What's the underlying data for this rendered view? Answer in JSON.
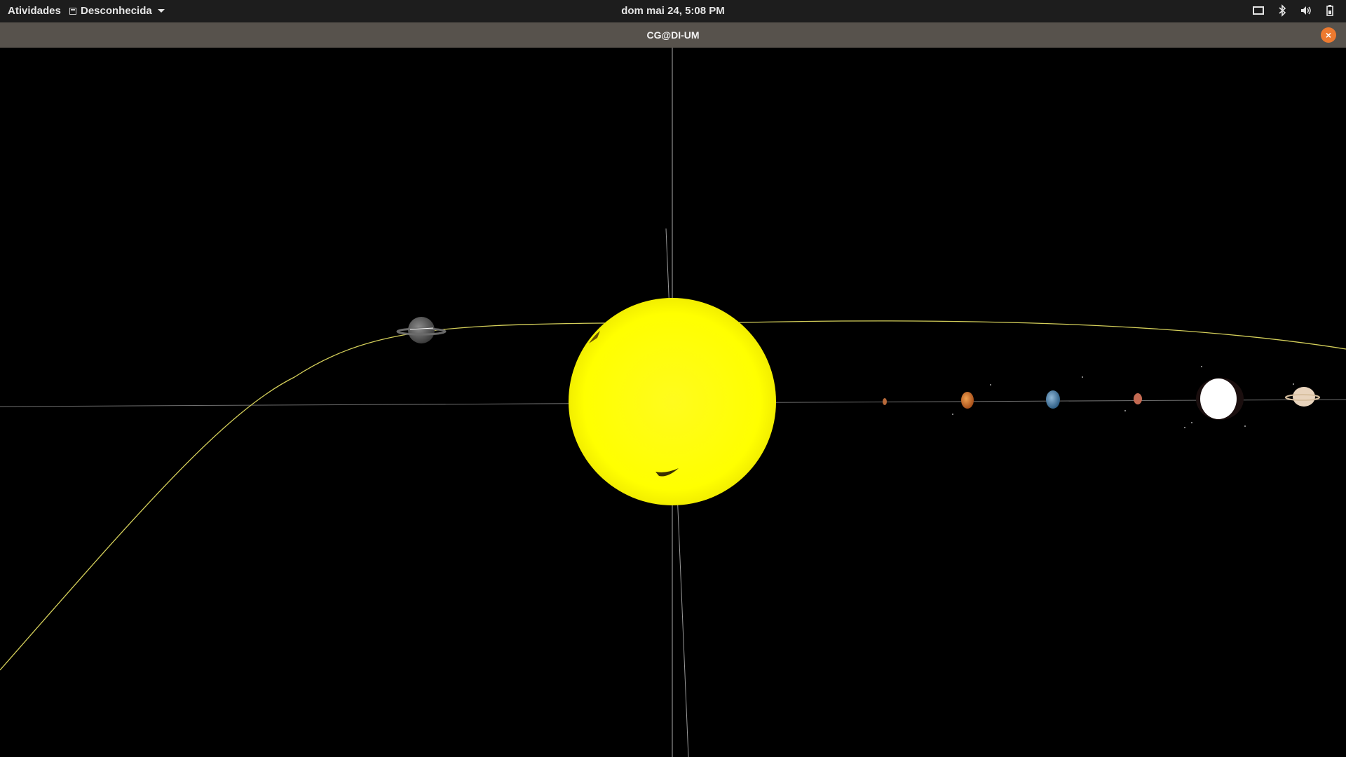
{
  "topbar": {
    "activities_label": "Atividades",
    "app_menu_label": "Desconhecida",
    "clock": "dom mai 24,  5:08 PM",
    "tray_icons": [
      "screen-icon",
      "bluetooth-icon",
      "volume-icon",
      "battery-icon"
    ]
  },
  "window": {
    "title": "CG@DI-UM",
    "close_symbol": "×"
  },
  "scene": {
    "background": "#000000",
    "sun_color": "#ffff00",
    "orbit_color": "#d4cf5a",
    "axis_color": "#9a9a9a",
    "bodies": [
      "sun",
      "comet-ringed-body",
      "mercury",
      "venus",
      "earth",
      "mars",
      "jupiter",
      "saturn"
    ]
  }
}
